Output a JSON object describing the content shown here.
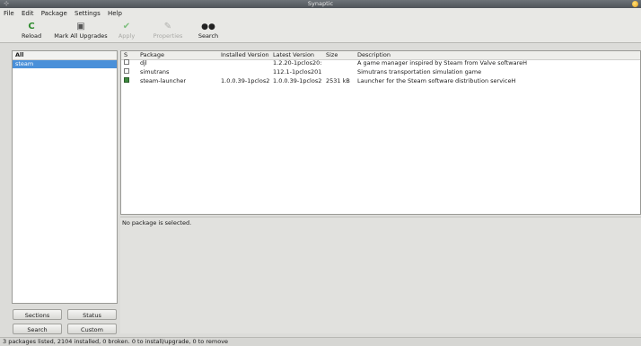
{
  "window": {
    "title": "Synaptic"
  },
  "menu": [
    "File",
    "Edit",
    "Package",
    "Settings",
    "Help"
  ],
  "toolbar": {
    "reload": "Reload",
    "mark_all": "Mark All Upgrades",
    "apply": "Apply",
    "properties": "Properties",
    "search": "Search"
  },
  "filter": {
    "header": "All",
    "selected": "steam"
  },
  "filter_buttons": {
    "sections": "Sections",
    "status": "Status",
    "search": "Search",
    "custom": "Custom"
  },
  "columns": {
    "s": "S",
    "package": "Package",
    "installed": "Installed Version",
    "latest": "Latest Version",
    "size": "Size",
    "description": "Description"
  },
  "packages": [
    {
      "name": "djl",
      "installed": "",
      "latest": "1.2.20-1pclos20:",
      "size": "",
      "description": "A game manager inspired by Steam from Valve softwareH",
      "state": "not-installed"
    },
    {
      "name": "simutrans",
      "installed": "",
      "latest": "112.1-1pclos201",
      "size": "",
      "description": "Simutrans transportation simulation game",
      "state": "not-installed"
    },
    {
      "name": "steam-launcher",
      "installed": "1.0.0.39-1pclos2",
      "latest": "1.0.0.39-1pclos2",
      "size": "2531 kB",
      "description": "Launcher for the Steam software distribution serviceH",
      "state": "installed"
    }
  ],
  "info": {
    "text": "No package is selected."
  },
  "status": {
    "text": "3 packages listed, 2104 installed, 0 broken. 0 to install/upgrade, 0 to remove"
  },
  "icons": {
    "reload": "reload-icon",
    "mark_all": "mark-all-upgrades-icon",
    "apply": "apply-icon",
    "properties": "properties-icon",
    "search": "search-icon"
  },
  "colors": {
    "selection": "#4a90d9",
    "installed": "#3f8a3f",
    "reload_icon": "#2e8b2e"
  }
}
